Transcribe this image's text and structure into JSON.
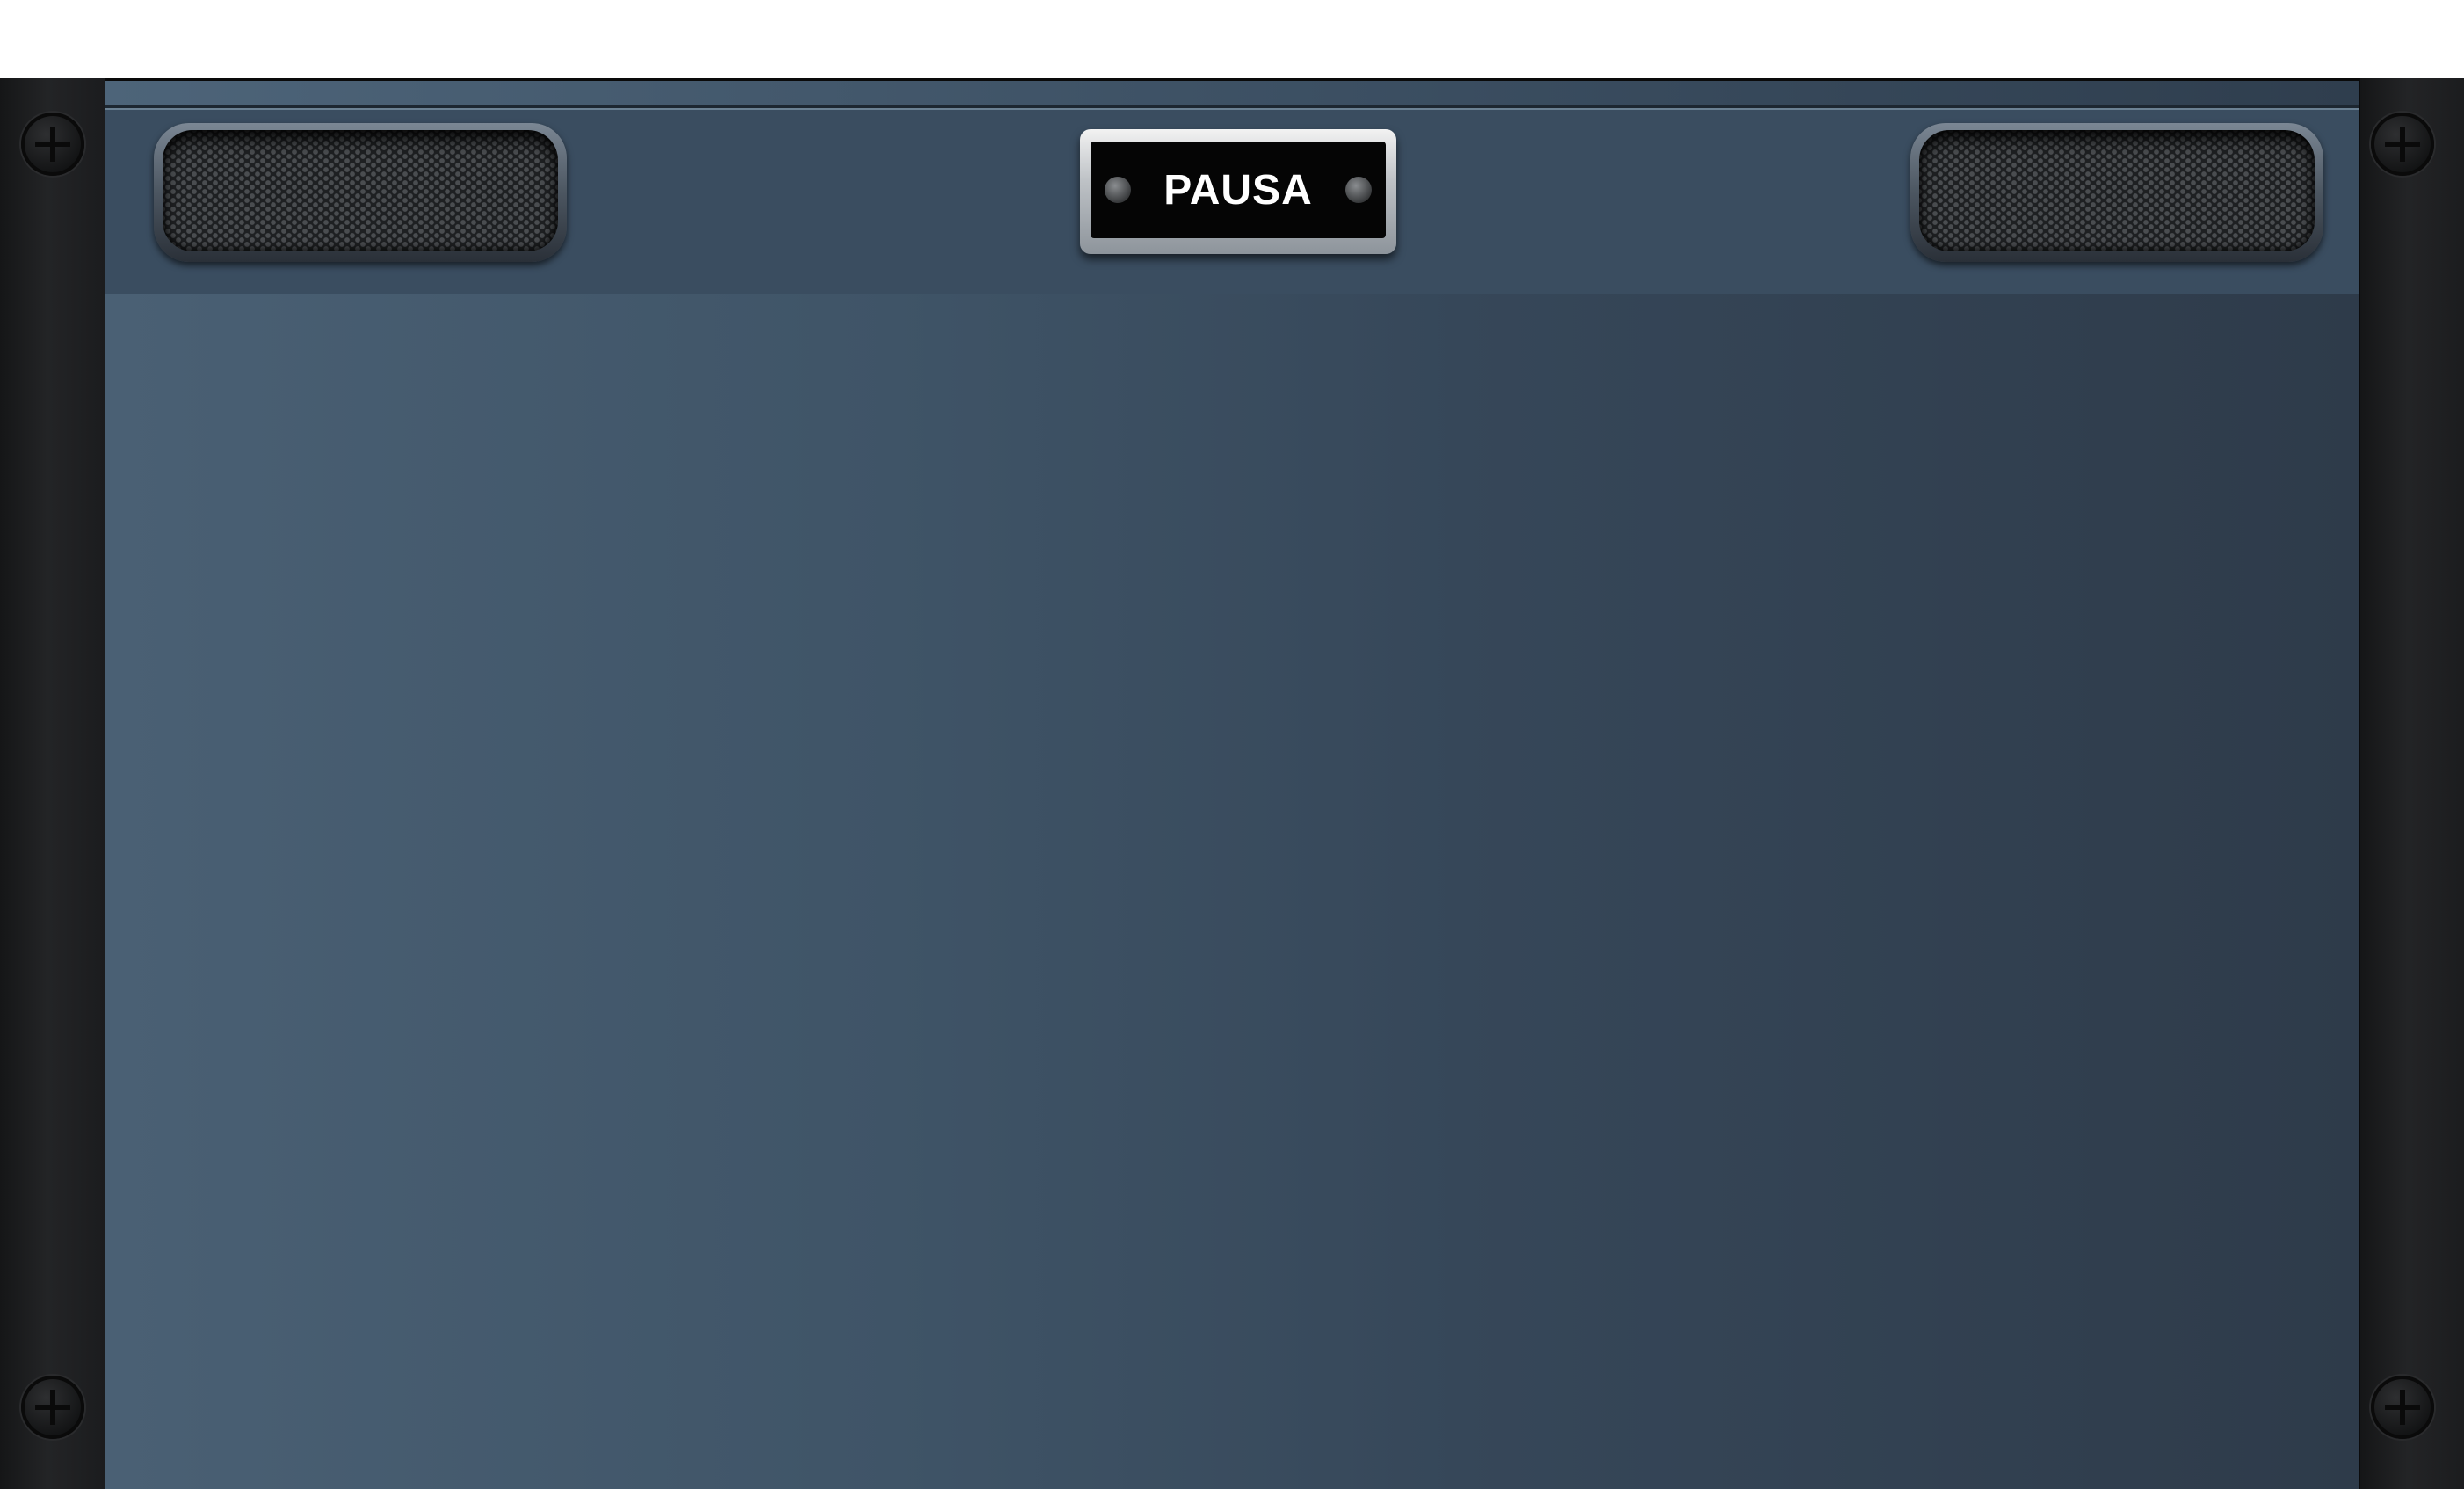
{
  "header": {
    "pause_label": "PAUSA"
  },
  "icons": {
    "screw": "screw-icon",
    "speaker": "speaker-grille"
  },
  "colors": {
    "panel_blue": "#3f5467",
    "frame_black": "#1a1b1d",
    "badge_black": "#050505",
    "label_white": "#ffffff"
  }
}
